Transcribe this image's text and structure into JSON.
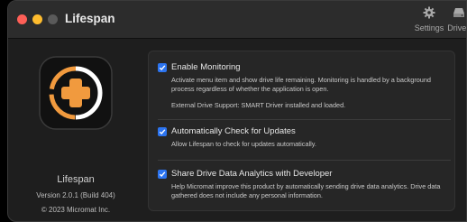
{
  "window": {
    "title": "Lifespan",
    "toolbar": [
      {
        "name": "Settings",
        "icon": "gear-icon"
      },
      {
        "name": "Drives",
        "icon": "drive-icon"
      }
    ]
  },
  "about": {
    "name": "Lifespan",
    "version": "Version 2.0.1 (Build 404)",
    "copyright": "© 2023 Micromat Inc."
  },
  "options": [
    {
      "label": "Enable Monitoring",
      "checked": true,
      "description": "Activate menu item and show drive life remaining. Monitoring is handled by a background process regardless of whether the application is open.",
      "extra": "External Drive Support: SMART Driver installed and loaded."
    },
    {
      "label": "Automatically Check for Updates",
      "checked": true,
      "description": "Allow Lifespan to check for updates automatically."
    },
    {
      "label": "Share Drive Data Analytics with Developer",
      "checked": true,
      "description": "Help Micromat improve this product by automatically sending drive data analytics. Drive data gathered does not include any personal information."
    }
  ],
  "colors": {
    "accent": "#2c74f0",
    "icon_orange": "#f19a3e",
    "window_bg": "#1e1e1e"
  }
}
